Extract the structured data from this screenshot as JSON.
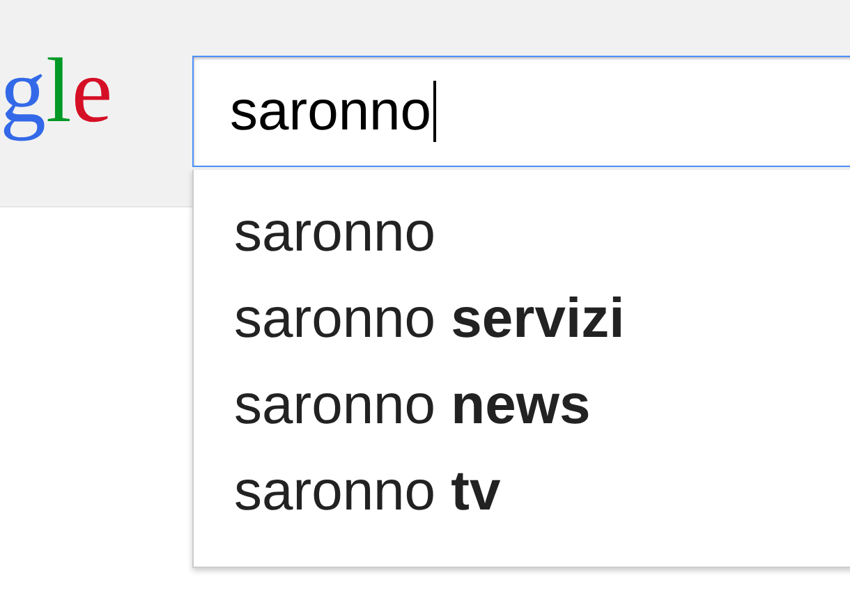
{
  "logo": {
    "letters": [
      {
        "text": "g",
        "color": "#3369e8"
      },
      {
        "text": "l",
        "color": "#009925"
      },
      {
        "text": "e",
        "color": "#d50f25"
      }
    ]
  },
  "search": {
    "value": "saronno",
    "focused": true
  },
  "suggestions": [
    {
      "text": "saronno"
    },
    {
      "text": "saronno **servizi**"
    },
    {
      "text": "saronno **news**"
    },
    {
      "text": "saronno **tv**"
    }
  ]
}
